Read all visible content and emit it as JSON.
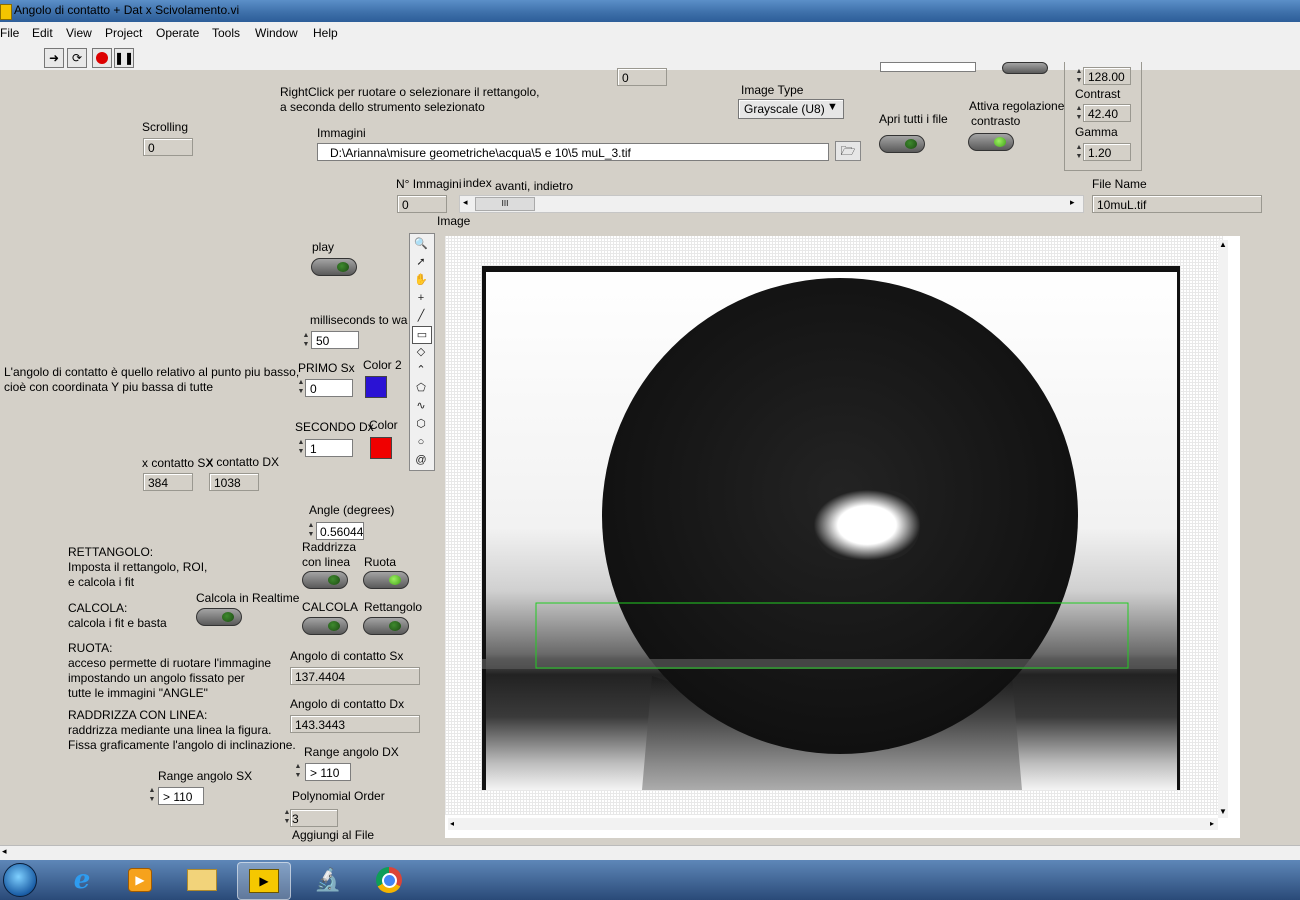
{
  "window": {
    "title": "Angolo di contatto + Dat x Scivolamento.vi"
  },
  "menu": [
    "File",
    "Edit",
    "View",
    "Project",
    "Operate",
    "Tools",
    "Window",
    "Help"
  ],
  "help": {
    "rightclick": "RightClick per ruotare o selezionare il rettangolo,",
    "rightclick2": "a seconda dello strumento selezionato"
  },
  "controls": {
    "top_num": "0",
    "scrolling_label": "Scrolling",
    "scrolling_value": "0",
    "immagini_label": "Immagini",
    "immagini_path": "D:\\Arianna\\misure geometriche\\acqua\\5 e 10\\5 muL_3.tif",
    "image_type_label": "Image Type",
    "image_type_value": "Grayscale (U8)",
    "apri_label": "Apri tutti i file",
    "attiva_label": "Attiva regolazione",
    "attiva_label2": "contrasto",
    "brightness_value": "128.00",
    "contrast_label": "Contrast",
    "contrast_value": "42.40",
    "gamma_label": "Gamma",
    "gamma_value": "1.20",
    "n_immagini_label": "N° Immagini",
    "n_immagini_value": "0",
    "index_label": "index",
    "avanti_label": "avanti, indietro",
    "file_name_label": "File Name",
    "file_name_value": "10muL.tif",
    "image_label": "Image",
    "play_label": "play",
    "ms_label": "milliseconds to wa",
    "ms_value": "50",
    "primo_label": "PRIMO Sx",
    "primo_value": "0",
    "color2_label": "Color 2",
    "secondo_label": "SECONDO Dx",
    "secondo_value": "1",
    "color_label": "Color",
    "contact_note1": "L'angolo di contatto è quello relativo al punto piu basso,",
    "contact_note2": "cioè con coordinata Y piu bassa di tutte",
    "x_sx_label": "x contatto SX",
    "x_sx_value": "384",
    "x_dx_label": "x contatto DX",
    "x_dx_value": "1038",
    "angle_label": "Angle (degrees)",
    "angle_value": "0.560442",
    "raddrizza_label": "Raddrizza",
    "raddrizza_label2": "con linea",
    "ruota_label": "Ruota",
    "calcola_label": "CALCOLA",
    "rettangolo_label": "Rettangolo",
    "realtime_label": "Calcola in Realtime",
    "ang_sx_label": "Angolo di contatto  Sx",
    "ang_sx_value": "137.4404",
    "ang_dx_label": "Angolo di contatto  Dx",
    "ang_dx_value": "143.3443",
    "range_dx_label": "Range angolo DX",
    "range_dx_value": "> 110",
    "range_sx_label": "Range angolo SX",
    "range_sx_value": "> 110",
    "poly_label": "Polynomial Order",
    "poly_value": "3",
    "aggiungi_label": "Aggiungi al File"
  },
  "instructions": {
    "r1": "RETTANGOLO:",
    "r2": "Imposta il rettangolo, ROI,",
    "r3": " e calcola i fit",
    "c1": "CALCOLA:",
    "c2": "calcola i fit e basta",
    "u1": "RUOTA:",
    "u2": "acceso permette di ruotare l'immagine",
    "u3": "impostando un angolo fissato per",
    "u4": "tutte le immagini \"ANGLE\"",
    "l1": "RADDRIZZA CON LINEA:",
    "l2": "raddrizza mediante una linea la figura.",
    "l3": "Fissa graficamente l'angolo di inclinazione."
  },
  "colors": {
    "color2": "#2a12d4",
    "color": "#f00000",
    "roi": "#22cc22"
  },
  "taskbar": [
    "start-orb",
    "ie-icon",
    "media-player-icon",
    "explorer-icon",
    "labview-icon",
    "microscope-icon",
    "chrome-icon"
  ]
}
